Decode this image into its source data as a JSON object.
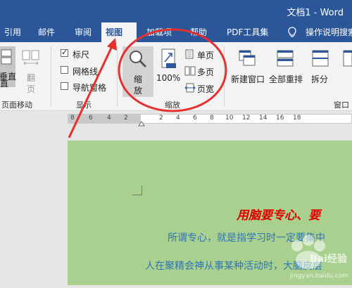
{
  "window": {
    "title": "文档1 - Word"
  },
  "tabs": [
    "引用",
    "邮件",
    "审阅",
    "视图",
    "加载项",
    "帮助",
    "PDF工具集",
    "操作说明搜索"
  ],
  "ribbon": {
    "page_move": {
      "vertical": "垂直",
      "vertical_sub": "直",
      "flip": "翻",
      "flip_sub": "页",
      "label": "页面移动"
    },
    "show": {
      "ruler": "标尺",
      "gridlines": "网格线",
      "nav_pane": "导航窗格",
      "label": "显示"
    },
    "zoom": {
      "zoom_btn": "缩",
      "zoom_btn2": "放",
      "pct": "100%",
      "one_page": "单页",
      "multi_page": "多页",
      "page_width": "页宽",
      "label": "缩放"
    },
    "window": {
      "new_window": "新建窗口",
      "arrange_all": "全部重排",
      "split": "拆分",
      "label": "窗口"
    }
  },
  "ruler": {
    "ticks": [
      "8",
      "6",
      "4",
      "2",
      "2",
      "4",
      "6",
      "8",
      "10",
      "12",
      "14",
      "16",
      "18"
    ]
  },
  "document": {
    "heading": "用脑要专心、",
    "heading_tail": "要",
    "line1": "所谓专心，就是指学习时一定要集中",
    "line2": "人在聚精会神从事某种活动时，大脑皮层"
  },
  "watermark": {
    "text": "Bai经验",
    "sub": "jingyan.baidu.com"
  },
  "colors": {
    "accent": "#2b579a",
    "page": "#a9d08e",
    "heading": "#e00000",
    "body_text": "#2e75b6",
    "annotation": "#e53030"
  }
}
